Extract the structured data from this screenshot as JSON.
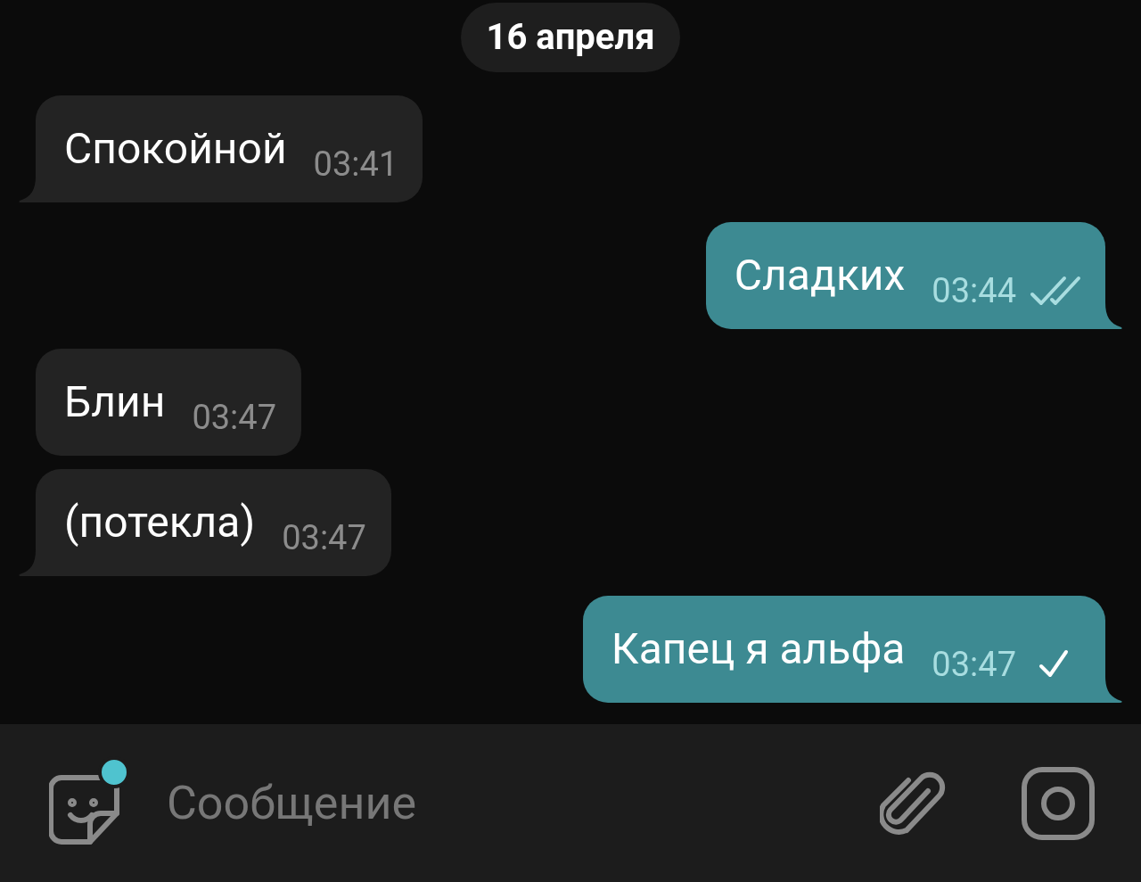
{
  "date": "16 апреля",
  "messages": [
    {
      "kind": "incoming",
      "text": "Спокойной",
      "time": "03:41"
    },
    {
      "kind": "outgoing",
      "text": "Сладких",
      "time": "03:44",
      "read": true
    },
    {
      "kind": "incoming",
      "text": "Блин",
      "time": "03:47"
    },
    {
      "kind": "incoming",
      "text": "(потекла)",
      "time": "03:47"
    },
    {
      "kind": "outgoing",
      "text": "Капец я альфа",
      "time": "03:47",
      "read": false
    }
  ],
  "composer": {
    "placeholder": "Сообщение",
    "sticker_badge": true
  }
}
